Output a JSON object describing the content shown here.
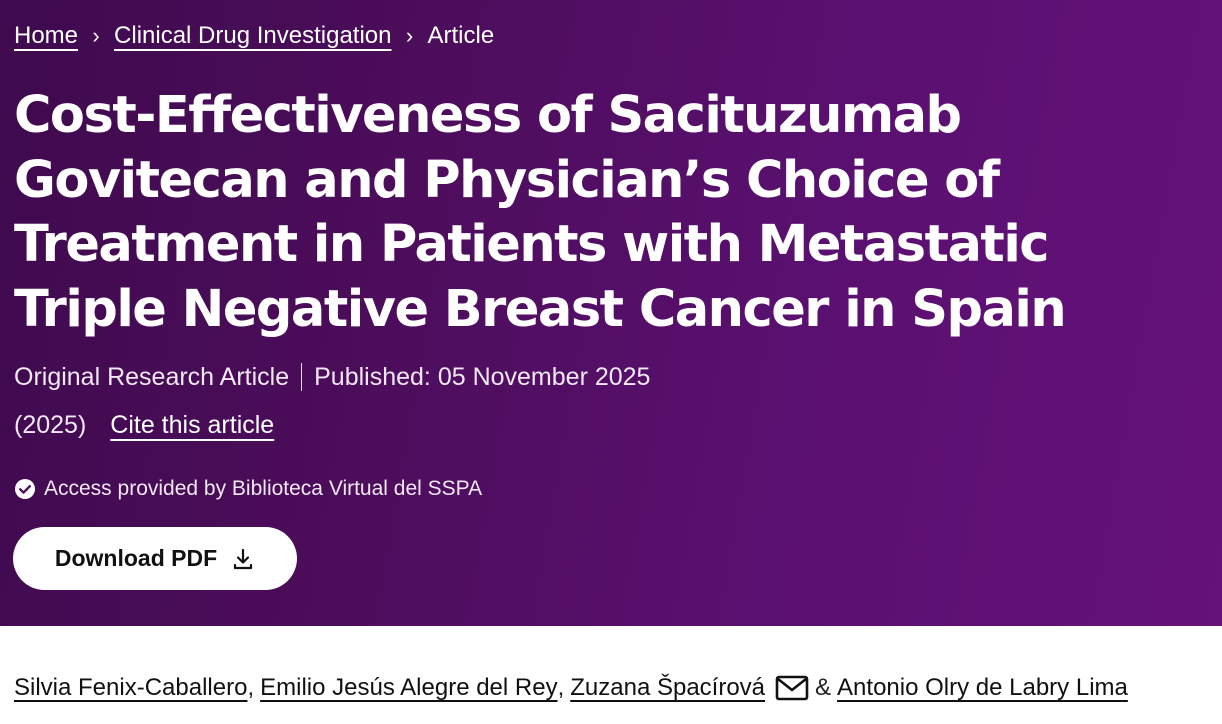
{
  "breadcrumb": {
    "items": [
      {
        "label": "Home"
      },
      {
        "label": "Clinical Drug Investigation"
      }
    ],
    "current": "Article",
    "separator": "›"
  },
  "article": {
    "title": "Cost-Effectiveness of Sacituzumab Govitecan and Physician’s Choice of Treatment in Patients with Metastatic Triple Negative Breast Cancer in Spain",
    "type": "Original Research Article",
    "published": "Published: 05 November 2025",
    "year": "(2025)",
    "cite_label": "Cite this article",
    "access_text": "Access provided by Biblioteca Virtual del SSPA",
    "download_label": "Download PDF"
  },
  "authors": {
    "list": [
      {
        "name": "Silvia Fenix-Caballero",
        "suffix": ","
      },
      {
        "name": "Emilio Jesús Alegre del Rey",
        "suffix": ","
      },
      {
        "name": "Zuzana Špacírová",
        "suffix": ""
      }
    ],
    "ampersand": "&",
    "last": "Antonio Olry de Labry Lima"
  },
  "icons": {
    "access": "check-circle-icon",
    "download": "download-icon",
    "corresponding": "mail-icon"
  },
  "colors": {
    "hero_start": "#3f0a4e",
    "hero_end": "#65127a",
    "text_on_hero": "#ffffff",
    "button_bg": "#ffffff"
  }
}
